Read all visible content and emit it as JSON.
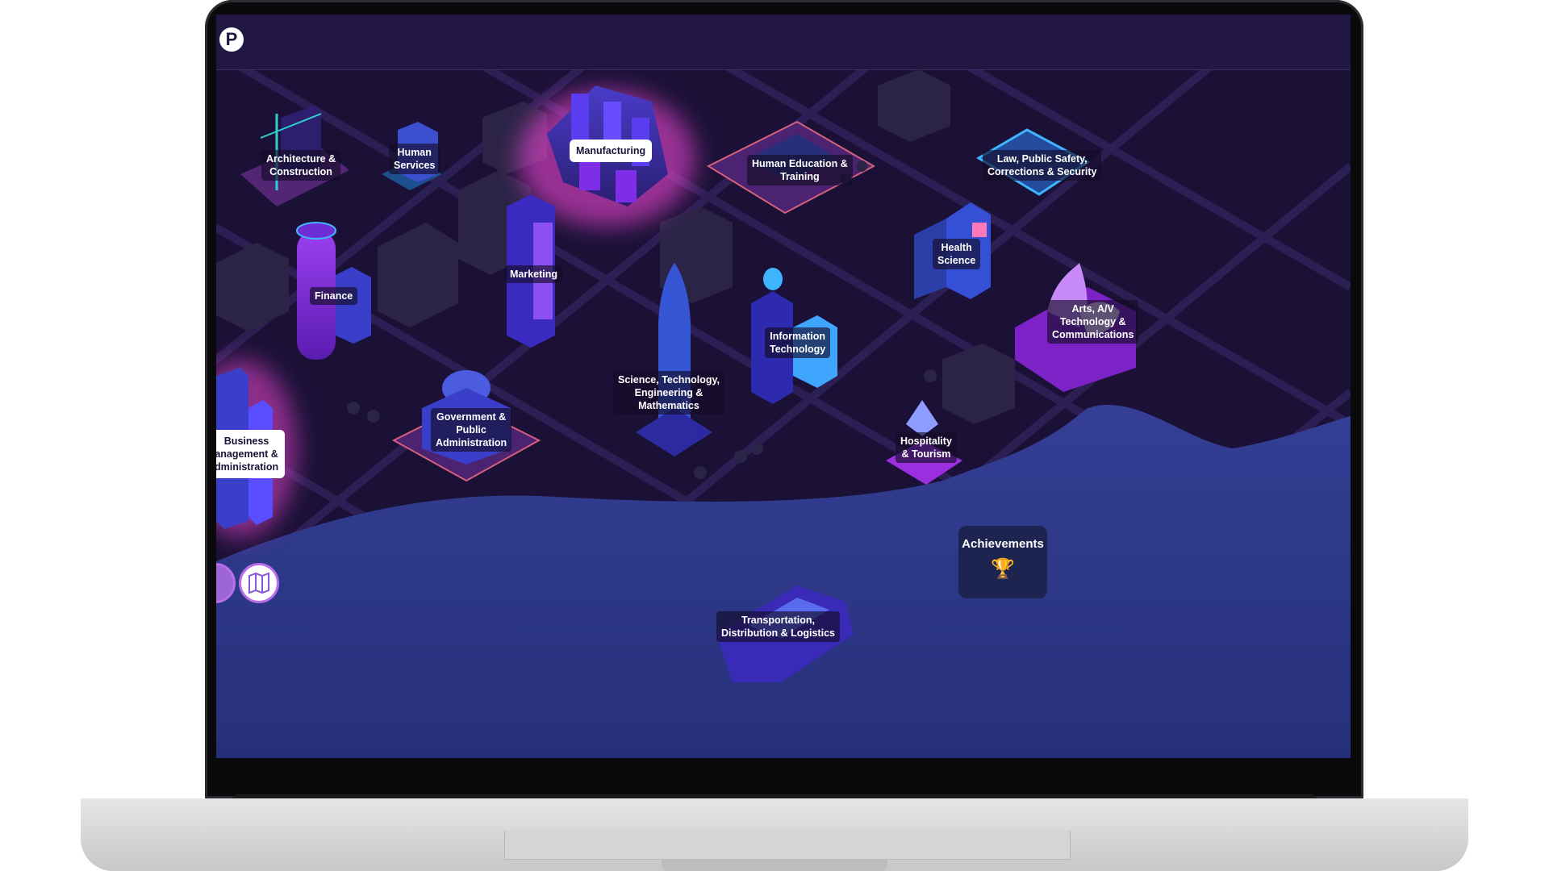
{
  "app": {
    "logo_letter": "P"
  },
  "map": {
    "buildings": [
      {
        "id": "architecture",
        "label": "Architecture &\nConstruction",
        "highlighted": false
      },
      {
        "id": "human-services",
        "label": "Human\nServices",
        "highlighted": false
      },
      {
        "id": "manufacturing",
        "label": "Manufacturing",
        "highlighted": true
      },
      {
        "id": "human-education",
        "label": "Human Education &\nTraining",
        "highlighted": false
      },
      {
        "id": "law",
        "label": "Law, Public Safety,\nCorrections & Security",
        "highlighted": false
      },
      {
        "id": "health",
        "label": "Health\nScience",
        "highlighted": false
      },
      {
        "id": "finance",
        "label": "Finance",
        "highlighted": false
      },
      {
        "id": "marketing",
        "label": "Marketing",
        "highlighted": false
      },
      {
        "id": "arts",
        "label": "Arts, A/V\nTechnology &\nCommunications",
        "highlighted": false
      },
      {
        "id": "it",
        "label": "Information\nTechnology",
        "highlighted": false
      },
      {
        "id": "stem",
        "label": "Science, Technology,\nEngineering &\nMathematics",
        "highlighted": false
      },
      {
        "id": "government",
        "label": "Government &\nPublic\nAdministration",
        "highlighted": false
      },
      {
        "id": "business",
        "label": "Business\nanagement &\ndministration",
        "highlighted": true
      },
      {
        "id": "hospitality",
        "label": "Hospitality\n& Tourism",
        "highlighted": false
      },
      {
        "id": "transportation",
        "label": "Transportation,\nDistribution & Logistics",
        "highlighted": false
      }
    ]
  },
  "achievements": {
    "title": "Achievements",
    "icon": "trophy-icon"
  },
  "controls": {
    "map_button_icon": "map-icon",
    "avatar_icon": "avatar-icon"
  },
  "colors": {
    "background": "#1b1137",
    "water": "#2f3b8c",
    "accent": "#b76ee8",
    "glow": "#ff4be0"
  }
}
